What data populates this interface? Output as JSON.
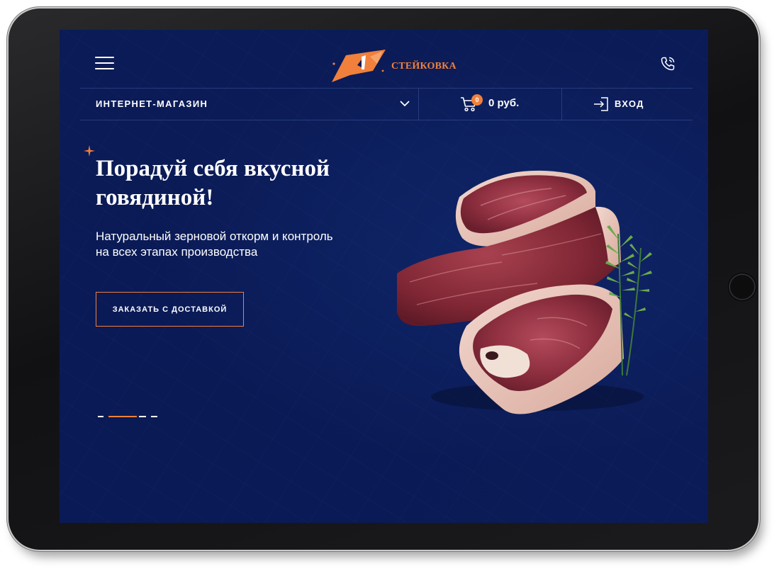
{
  "header": {
    "menu_icon": "hamburger-menu-icon",
    "logo_text": "СТЕЙКОВКА",
    "phone_icon": "phone-icon"
  },
  "nav": {
    "shop_label": "ИНТЕРНЕТ-МАГАЗИН",
    "shop_icon": "chevron-down-icon",
    "cart_count": "0",
    "cart_sum": "0 руб.",
    "cart_icon": "cart-icon",
    "login_label": "ВХОД",
    "login_icon": "login-icon"
  },
  "hero": {
    "title_line1": "Порадуй себя вкусной",
    "title_line2": "говядиной!",
    "subtitle_line1": "Натуральный зерновой откорм и контроль",
    "subtitle_line2": "на всех этапах производства",
    "cta_label": "ЗАКАЗАТЬ С ДОСТАВКОЙ",
    "image": "raw-beef-steaks-with-rosemary",
    "slides_total": 4,
    "active_slide": 2
  },
  "colors": {
    "accent": "#f0803c",
    "background": "#0b1b57",
    "text": "#ffffff"
  }
}
